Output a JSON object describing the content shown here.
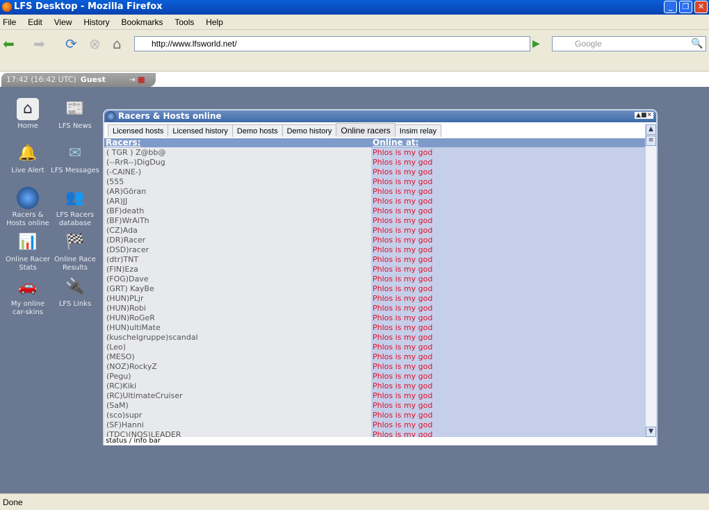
{
  "browser": {
    "title": "LFS Desktop - Mozilla Firefox",
    "menu": [
      "File",
      "Edit",
      "View",
      "History",
      "Bookmarks",
      "Tools",
      "Help"
    ],
    "url": "http://www.lfsworld.net/",
    "search_placeholder": "Google",
    "status": "Done"
  },
  "site": {
    "time": "17:42 (16:42 UTC)",
    "user": "Guest",
    "icons": [
      {
        "label": "Home",
        "icon": "home-icon"
      },
      {
        "label": "LFS News",
        "icon": "newspaper-icon"
      },
      {
        "label": "Live Alert",
        "icon": "bell-icon"
      },
      {
        "label": "LFS Messages",
        "icon": "envelope-icon"
      },
      {
        "label": "Racers & Hosts online",
        "icon": "globe-icon"
      },
      {
        "label": "LFS Racers database",
        "icon": "people-icon"
      },
      {
        "label": "Online Racer Stats",
        "icon": "stats-icon"
      },
      {
        "label": "Online Race Results",
        "icon": "checkered-flag-icon"
      },
      {
        "label": "My online car-skins",
        "icon": "car-paint-icon"
      },
      {
        "label": "LFS Links",
        "icon": "plug-icon"
      }
    ]
  },
  "window": {
    "title": "Racers & Hosts online",
    "tabs": [
      "Licensed hosts",
      "Licensed history",
      "Demo hosts",
      "Demo history",
      "Online racers",
      "Insim relay"
    ],
    "active_tab": "Online racers",
    "col_racers": "Racers:",
    "col_online": "Online at:",
    "status": "status / info bar",
    "rows": [
      {
        "name": "( TGR ) Z@bb@",
        "host": "Phlos is my god"
      },
      {
        "name": "(--RrR--)DigDug",
        "host": "Phlos is my god"
      },
      {
        "name": "(-CAINE-)",
        "host": "Phlos is my god"
      },
      {
        "name": "(555",
        "host": "Phlos is my god"
      },
      {
        "name": "(AR)Göran",
        "host": "Phlos is my god"
      },
      {
        "name": "(AR)JJ",
        "host": "Phlos is my god"
      },
      {
        "name": "(BF)death",
        "host": "Phlos is my god"
      },
      {
        "name": "(BF)WrAiTh",
        "host": "Phlos is my god"
      },
      {
        "name": "(CZ)Ada",
        "host": "Phlos is my god"
      },
      {
        "name": "(DR)Racer",
        "host": "Phlos is my god"
      },
      {
        "name": "(DSD)racer",
        "host": "Phlos is my god"
      },
      {
        "name": "(dtr)TNT",
        "host": "Phlos is my god"
      },
      {
        "name": "(FIN)Eza",
        "host": "Phlos is my god"
      },
      {
        "name": "(FOG)Dave",
        "host": "Phlos is my god"
      },
      {
        "name": "(GRT) KayBe",
        "host": "Phlos is my god"
      },
      {
        "name": "(HUN)PLjr",
        "host": "Phlos is my god"
      },
      {
        "name": "(HUN)Robi",
        "host": "Phlos is my god"
      },
      {
        "name": "(HUN)RoGeR",
        "host": "Phlos is my god"
      },
      {
        "name": "(HUN)ultiMate",
        "host": "Phlos is my god"
      },
      {
        "name": "(kuschelgruppe)scandal",
        "host": "Phlos is my god"
      },
      {
        "name": "(Leo)",
        "host": "Phlos is my god"
      },
      {
        "name": "(MESO)",
        "host": "Phlos is my god"
      },
      {
        "name": "(NOZ)RockyZ",
        "host": "Phlos is my god"
      },
      {
        "name": "(Pegu)",
        "host": "Phlos is my god"
      },
      {
        "name": "(RC)Kiki",
        "host": "Phlos is my god"
      },
      {
        "name": "(RC)UltimateCruiser",
        "host": "Phlos is my god"
      },
      {
        "name": "(SaM)",
        "host": "Phlos is my god"
      },
      {
        "name": "(sco)supr",
        "host": "Phlos is my god"
      },
      {
        "name": "(SF)Hanni",
        "host": "Phlos is my god"
      },
      {
        "name": "(TDC)(NOS)LEADER",
        "host": "Phlos is my god"
      }
    ]
  },
  "colors": {
    "desktop": "#6b7891",
    "online_host": "#e0102a",
    "header": "#7f9bc9"
  }
}
